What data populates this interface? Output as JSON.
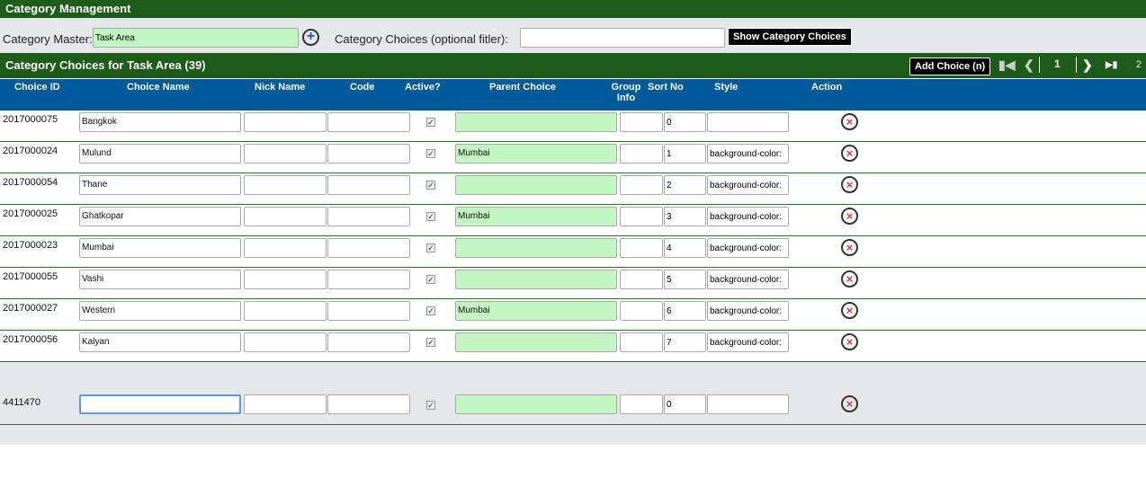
{
  "title": "Category Management",
  "filter": {
    "master_label": "Category Master:",
    "master_value": "Task Area",
    "choices_label": "Category Choices (optional fitler):",
    "choices_value": "",
    "show_button": "Show Category Choices"
  },
  "section": {
    "title": "Category Choices for Task Area (39)",
    "add_button": "Add Choice (n)",
    "current_page": "1",
    "total_pages": "2"
  },
  "columns": [
    "Choice ID",
    "Choice Name",
    "Nick Name",
    "Code",
    "Active?",
    "Parent Choice",
    "Group Info",
    "Sort No",
    "Style",
    "Action"
  ],
  "rows": [
    {
      "id": "2017000075",
      "name": "Bangkok",
      "parent": "",
      "sort": "0",
      "style": ""
    },
    {
      "id": "2017000024",
      "name": "Mulund",
      "parent": "Mumbai",
      "sort": "1",
      "style": "background-color:"
    },
    {
      "id": "2017000054",
      "name": "Thane",
      "parent": "",
      "sort": "2",
      "style": "background-color:"
    },
    {
      "id": "2017000025",
      "name": "Ghatkopar",
      "parent": "Mumbai",
      "sort": "3",
      "style": "background-color:"
    },
    {
      "id": "2017000023",
      "name": "Mumbai",
      "parent": "",
      "sort": "4",
      "style": "background-color:"
    },
    {
      "id": "2017000055",
      "name": "Vashi",
      "parent": "",
      "sort": "5",
      "style": "background-color:"
    },
    {
      "id": "2017000027",
      "name": "Western",
      "parent": "Mumbai",
      "sort": "6",
      "style": "background-color:"
    },
    {
      "id": "2017000056",
      "name": "Kalyan",
      "parent": "",
      "sort": "7",
      "style": "background-color:"
    }
  ],
  "new_row": {
    "id": "4411470",
    "name": "",
    "parent": "",
    "sort": "0",
    "style": ""
  }
}
